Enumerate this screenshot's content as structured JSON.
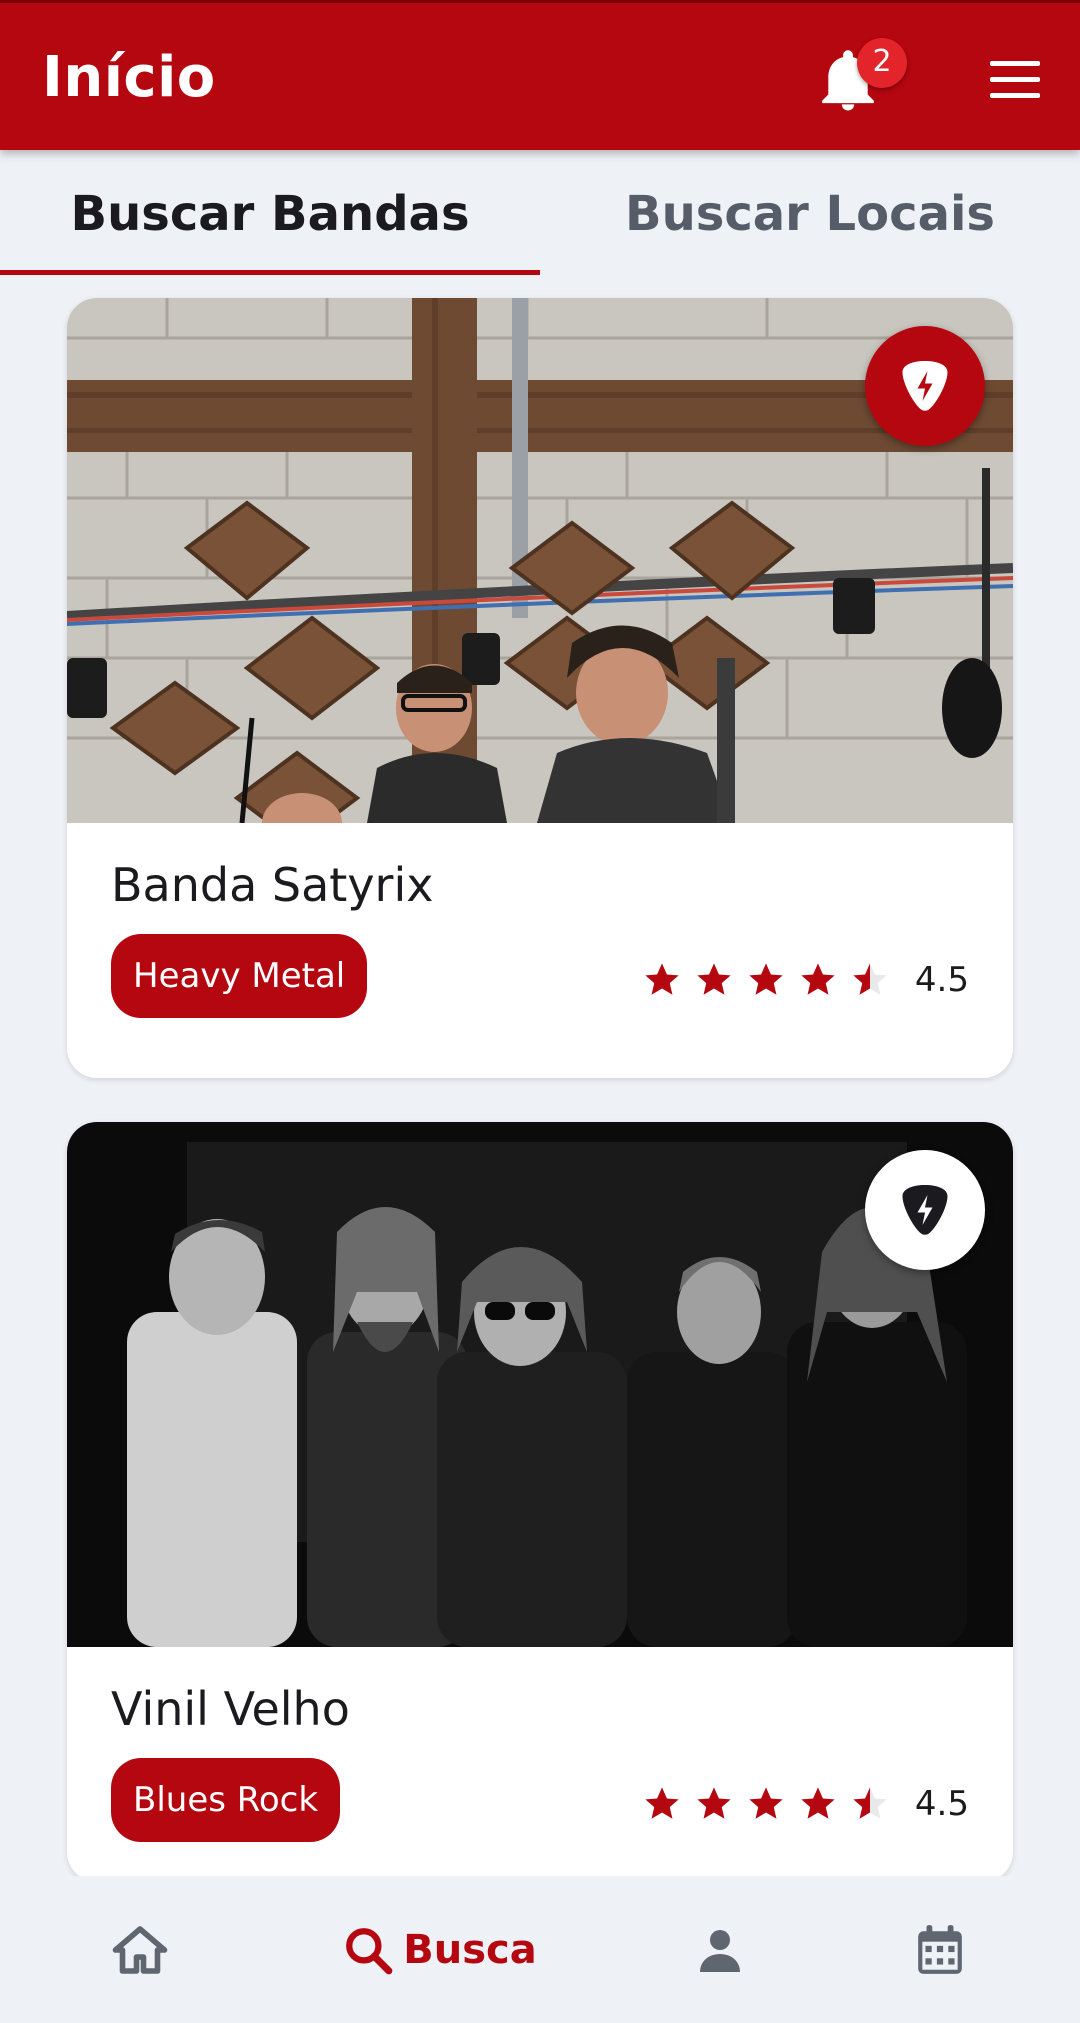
{
  "app_bar": {
    "title": "Início",
    "notification_count": "2",
    "colors": {
      "primary": "#b50710",
      "badge": "#e3242b"
    }
  },
  "tabs": [
    {
      "label": "Buscar Bandas",
      "active": true
    },
    {
      "label": "Buscar Locais",
      "active": false
    }
  ],
  "bands": [
    {
      "name": "Banda Satyrix",
      "genre": "Heavy Metal",
      "rating": "4.5",
      "rating_fraction": 0.9,
      "favorite": true,
      "photo": "band-photo-color"
    },
    {
      "name": "Vinil Velho",
      "genre": "Blues Rock",
      "rating": "4.5",
      "rating_fraction": 0.9,
      "favorite": false,
      "photo": "band-photo-grayscale"
    }
  ],
  "bottom_nav": {
    "items": [
      {
        "icon": "home-icon",
        "label": ""
      },
      {
        "icon": "search-icon",
        "label": "Busca",
        "active": true
      },
      {
        "icon": "person-icon",
        "label": ""
      },
      {
        "icon": "calendar-icon",
        "label": ""
      }
    ]
  }
}
